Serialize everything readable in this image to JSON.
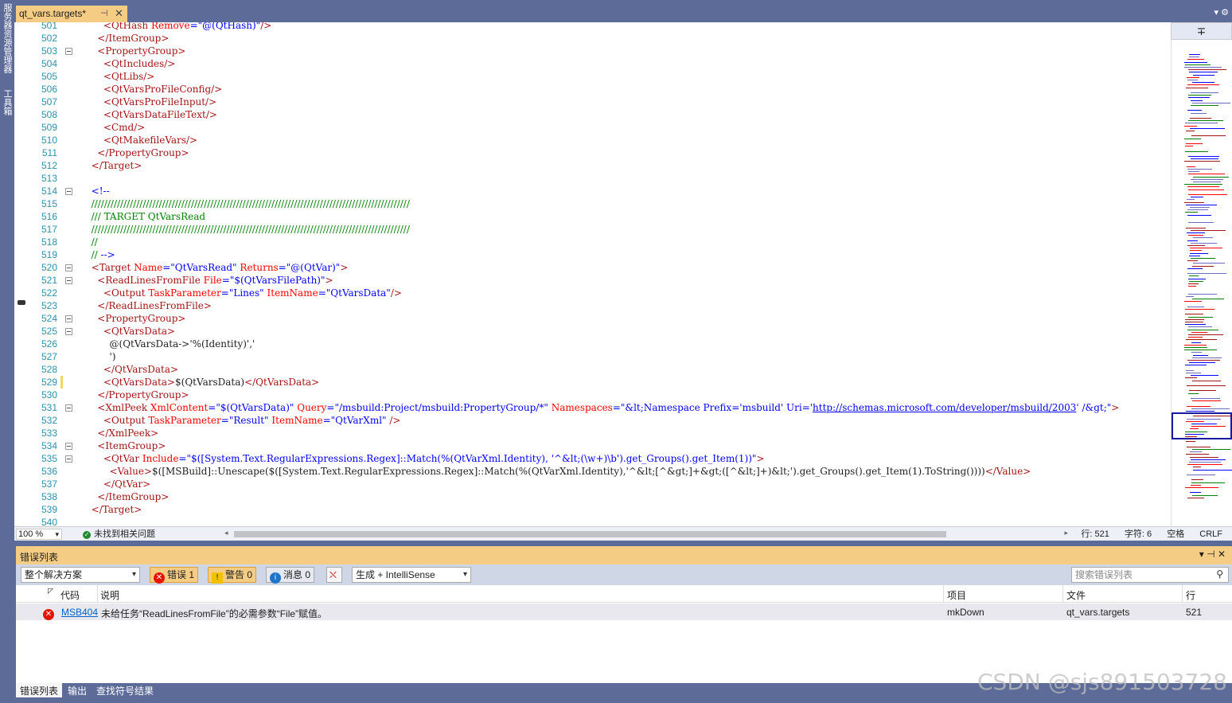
{
  "sidebar": {
    "tabs": [
      "服务器资源管理器",
      "工具箱"
    ]
  },
  "doc_tab": {
    "title": "qt_vars.targets*",
    "pin": "⊣",
    "close": "✕"
  },
  "tabs_right": "▾ ⚙",
  "editor": {
    "lines": [
      {
        "n": "501",
        "segs": [
          [
            "sp",
            "      "
          ],
          [
            "t",
            "<QtHash "
          ],
          [
            "a",
            "Remove"
          ],
          [
            "b",
            "="
          ],
          [
            "v",
            "\"@(QtHash)\""
          ],
          [
            "t",
            "/>"
          ]
        ]
      },
      {
        "n": "502",
        "segs": [
          [
            "sp",
            "    "
          ],
          [
            "t",
            "</ItemGroup>"
          ]
        ]
      },
      {
        "n": "503",
        "segs": [
          [
            "sp",
            "    "
          ],
          [
            "t",
            "<PropertyGroup>"
          ]
        ],
        "fold": true
      },
      {
        "n": "504",
        "segs": [
          [
            "sp",
            "      "
          ],
          [
            "t",
            "<QtIncludes/>"
          ]
        ]
      },
      {
        "n": "505",
        "segs": [
          [
            "sp",
            "      "
          ],
          [
            "t",
            "<QtLibs/>"
          ]
        ]
      },
      {
        "n": "506",
        "segs": [
          [
            "sp",
            "      "
          ],
          [
            "t",
            "<QtVarsProFileConfig/>"
          ]
        ]
      },
      {
        "n": "507",
        "segs": [
          [
            "sp",
            "      "
          ],
          [
            "t",
            "<QtVarsProFileInput/>"
          ]
        ]
      },
      {
        "n": "508",
        "segs": [
          [
            "sp",
            "      "
          ],
          [
            "t",
            "<QtVarsDataFileText/>"
          ]
        ]
      },
      {
        "n": "509",
        "segs": [
          [
            "sp",
            "      "
          ],
          [
            "t",
            "<Cmd/>"
          ]
        ]
      },
      {
        "n": "510",
        "segs": [
          [
            "sp",
            "      "
          ],
          [
            "t",
            "<QtMakefileVars/>"
          ]
        ]
      },
      {
        "n": "511",
        "segs": [
          [
            "sp",
            "    "
          ],
          [
            "t",
            "</PropertyGroup>"
          ]
        ]
      },
      {
        "n": "512",
        "segs": [
          [
            "sp",
            "  "
          ],
          [
            "t",
            "</Target>"
          ]
        ]
      },
      {
        "n": "513",
        "segs": []
      },
      {
        "n": "514",
        "segs": [
          [
            "sp",
            "  "
          ],
          [
            "b",
            "<!--"
          ]
        ],
        "fold": true
      },
      {
        "n": "515",
        "segs": [
          [
            "sp",
            "  "
          ],
          [
            "c",
            "///////////////////////////////////////////////////////////////////////////////////////////////////"
          ]
        ]
      },
      {
        "n": "516",
        "segs": [
          [
            "sp",
            "  "
          ],
          [
            "c",
            "/// TARGET QtVarsRead"
          ]
        ]
      },
      {
        "n": "517",
        "segs": [
          [
            "sp",
            "  "
          ],
          [
            "c",
            "///////////////////////////////////////////////////////////////////////////////////////////////////"
          ]
        ]
      },
      {
        "n": "518",
        "segs": [
          [
            "sp",
            "  "
          ],
          [
            "c",
            "//"
          ]
        ]
      },
      {
        "n": "519",
        "segs": [
          [
            "sp",
            "  "
          ],
          [
            "c",
            "// "
          ],
          [
            "b",
            "-->"
          ]
        ]
      },
      {
        "n": "520",
        "segs": [
          [
            "sp",
            "  "
          ],
          [
            "t",
            "<Target "
          ],
          [
            "a",
            "Name"
          ],
          [
            "b",
            "="
          ],
          [
            "v",
            "\"QtVarsRead\""
          ],
          [
            "t",
            " "
          ],
          [
            "a",
            "Returns"
          ],
          [
            "b",
            "="
          ],
          [
            "v",
            "\"@(QtVar)\""
          ],
          [
            "t",
            ">"
          ]
        ],
        "fold": true
      },
      {
        "n": "521",
        "segs": [
          [
            "sp",
            "    "
          ],
          [
            "t",
            "<ReadLinesFromFile "
          ],
          [
            "a",
            "File"
          ],
          [
            "b",
            "="
          ],
          [
            "v",
            "\"$(QtVarsFilePath)\""
          ],
          [
            "t",
            ">"
          ]
        ],
        "fold": true
      },
      {
        "n": "522",
        "segs": [
          [
            "sp",
            "      "
          ],
          [
            "t",
            "<Output "
          ],
          [
            "a",
            "TaskParameter"
          ],
          [
            "b",
            "="
          ],
          [
            "v",
            "\"Lines\""
          ],
          [
            "t",
            " "
          ],
          [
            "a",
            "ItemName"
          ],
          [
            "b",
            "="
          ],
          [
            "v",
            "\"QtVarsData\""
          ],
          [
            "t",
            "/>"
          ]
        ]
      },
      {
        "n": "523",
        "segs": [
          [
            "sp",
            "    "
          ],
          [
            "t",
            "</ReadLinesFromFile>"
          ]
        ]
      },
      {
        "n": "524",
        "segs": [
          [
            "sp",
            "    "
          ],
          [
            "t",
            "<PropertyGroup>"
          ]
        ],
        "fold": true
      },
      {
        "n": "525",
        "segs": [
          [
            "sp",
            "      "
          ],
          [
            "t",
            "<QtVarsData>"
          ]
        ],
        "fold": true
      },
      {
        "n": "526",
        "segs": [
          [
            "sp",
            "        "
          ],
          [
            "k",
            "@(QtVarsData->'%(Identity)','"
          ]
        ]
      },
      {
        "n": "527",
        "segs": [
          [
            "sp",
            "        "
          ],
          [
            "k",
            "')"
          ]
        ]
      },
      {
        "n": "528",
        "segs": [
          [
            "sp",
            "      "
          ],
          [
            "t",
            "</QtVarsData>"
          ]
        ]
      },
      {
        "n": "529",
        "segs": [
          [
            "sp",
            "      "
          ],
          [
            "t",
            "<QtVarsData>"
          ],
          [
            "k",
            "$(QtVarsData)"
          ],
          [
            "t",
            "</QtVarsData>"
          ]
        ],
        "chg": "#f2d75c"
      },
      {
        "n": "530",
        "segs": [
          [
            "sp",
            "    "
          ],
          [
            "t",
            "</PropertyGroup>"
          ]
        ]
      },
      {
        "n": "531",
        "segs": [
          [
            "sp",
            "    "
          ],
          [
            "t",
            "<XmlPeek "
          ],
          [
            "a",
            "XmlContent"
          ],
          [
            "b",
            "="
          ],
          [
            "v",
            "\"$(QtVarsData)\""
          ],
          [
            "t",
            " "
          ],
          [
            "a",
            "Query"
          ],
          [
            "b",
            "="
          ],
          [
            "v",
            "\"/msbuild:Project/msbuild:PropertyGroup/*\""
          ],
          [
            "t",
            " "
          ],
          [
            "a",
            "Namespaces"
          ],
          [
            "b",
            "="
          ],
          [
            "v",
            "\"&lt;Namespace Prefix='msbuild' Uri='"
          ],
          [
            "u",
            "http://schemas.microsoft.com/developer/msbuild/2003"
          ],
          [
            "v",
            "' /&gt;\""
          ],
          [
            "t",
            ">"
          ]
        ],
        "fold": true
      },
      {
        "n": "532",
        "segs": [
          [
            "sp",
            "      "
          ],
          [
            "t",
            "<Output "
          ],
          [
            "a",
            "TaskParameter"
          ],
          [
            "b",
            "="
          ],
          [
            "v",
            "\"Result\""
          ],
          [
            "t",
            " "
          ],
          [
            "a",
            "ItemName"
          ],
          [
            "b",
            "="
          ],
          [
            "v",
            "\"QtVarXml\""
          ],
          [
            "t",
            " />"
          ]
        ]
      },
      {
        "n": "533",
        "segs": [
          [
            "sp",
            "    "
          ],
          [
            "t",
            "</XmlPeek>"
          ]
        ]
      },
      {
        "n": "534",
        "segs": [
          [
            "sp",
            "    "
          ],
          [
            "t",
            "<ItemGroup>"
          ]
        ],
        "fold": true
      },
      {
        "n": "535",
        "segs": [
          [
            "sp",
            "      "
          ],
          [
            "t",
            "<QtVar "
          ],
          [
            "a",
            "Include"
          ],
          [
            "b",
            "="
          ],
          [
            "v",
            "\"$([System.Text.RegularExpressions.Regex]::Match(%(QtVarXml.Identity), '^&lt;(\\w+)\\b').get_Groups().get_Item(1))\""
          ],
          [
            "t",
            ">"
          ]
        ],
        "fold": true
      },
      {
        "n": "536",
        "segs": [
          [
            "sp",
            "        "
          ],
          [
            "t",
            "<Value>"
          ],
          [
            "k",
            "$([MSBuild]::Unescape($([System.Text.RegularExpressions.Regex]::Match(%(QtVarXml.Identity),'^&lt;[^&gt;]+&gt;(["
          ],
          [
            "k",
            "^&lt;]+)&lt;').get_Groups().get_Item(1).ToString())))"
          ],
          [
            "t",
            "</Value>"
          ]
        ]
      },
      {
        "n": "537",
        "segs": [
          [
            "sp",
            "      "
          ],
          [
            "t",
            "</QtVar>"
          ]
        ]
      },
      {
        "n": "538",
        "segs": [
          [
            "sp",
            "    "
          ],
          [
            "t",
            "</ItemGroup>"
          ]
        ]
      },
      {
        "n": "539",
        "segs": [
          [
            "sp",
            "  "
          ],
          [
            "t",
            "</Target>"
          ]
        ]
      },
      {
        "n": "540",
        "segs": []
      }
    ]
  },
  "status": {
    "zoom": "100 %",
    "no_issues": "未找到相关问题",
    "line": "行: 521",
    "char": "字符: 6",
    "spaces": "空格",
    "eol": "CRLF"
  },
  "error_list": {
    "title": "错误列表",
    "header_icons": "▾ ⊣ ✕",
    "scope": "整个解决方案",
    "errors_label": "错误 1",
    "warnings_label": "警告 0",
    "messages_label": "消息 0",
    "build_filter": "生成 + IntelliSense",
    "search_placeholder": "搜索错误列表",
    "columns": {
      "code": "代码",
      "desc": "说明",
      "project": "项目",
      "file": "文件",
      "line": "行"
    },
    "rows": [
      {
        "code": "MSB404",
        "desc": "未给任务“ReadLinesFromFile”的必需参数“File”赋值。",
        "project": "mkDown",
        "file": "qt_vars.targets",
        "line": "521"
      }
    ]
  },
  "bottom_tabs": [
    "错误列表",
    "输出",
    "查找符号结果"
  ],
  "watermark": "CSDN @sjs891503728",
  "colors": {
    "accent": "#f5cc84",
    "chrome": "#5d6b99",
    "tag": "#a31515",
    "attr": "#ff0000",
    "value": "#0000ff",
    "comment": "#008000"
  }
}
